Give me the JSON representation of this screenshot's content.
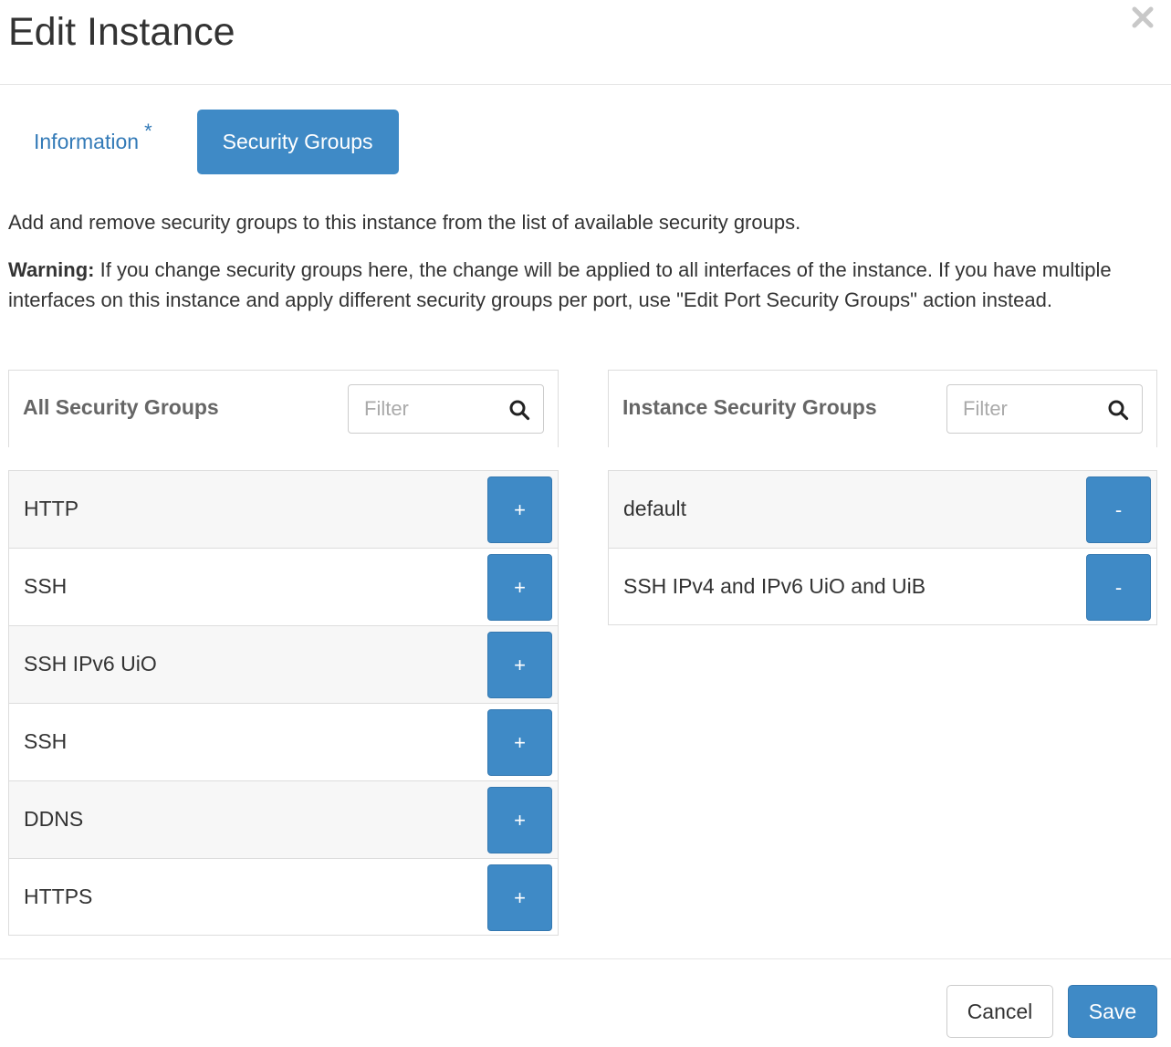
{
  "modal": {
    "title": "Edit Instance"
  },
  "tabs": [
    {
      "label": "Information",
      "required_marker": "*",
      "active": false
    },
    {
      "label": "Security Groups",
      "active": true
    }
  ],
  "description": "Add and remove security groups to this instance from the list of available security groups.",
  "warning": {
    "label": "Warning:",
    "text": " If you change security groups here, the change will be applied to all interfaces of the instance. If you have multiple interfaces on this instance and apply different security groups per port, use \"Edit Port Security Groups\" action instead."
  },
  "all_groups": {
    "title": "All Security Groups",
    "filter_placeholder": "Filter",
    "button_label": "+",
    "items": [
      {
        "name": "HTTP"
      },
      {
        "name": "SSH"
      },
      {
        "name": "SSH IPv6 UiO"
      },
      {
        "name": "SSH"
      },
      {
        "name": "DDNS"
      },
      {
        "name": "HTTPS"
      }
    ]
  },
  "instance_groups": {
    "title": "Instance Security Groups",
    "filter_placeholder": "Filter",
    "button_label": "-",
    "items": [
      {
        "name": "default"
      },
      {
        "name": "SSH IPv4 and IPv6 UiO and UiB"
      }
    ]
  },
  "footer": {
    "cancel_label": "Cancel",
    "save_label": "Save"
  },
  "colors": {
    "primary": "#3f8ac6",
    "link": "#337ab7",
    "row_shade": "#f7f7f7"
  }
}
